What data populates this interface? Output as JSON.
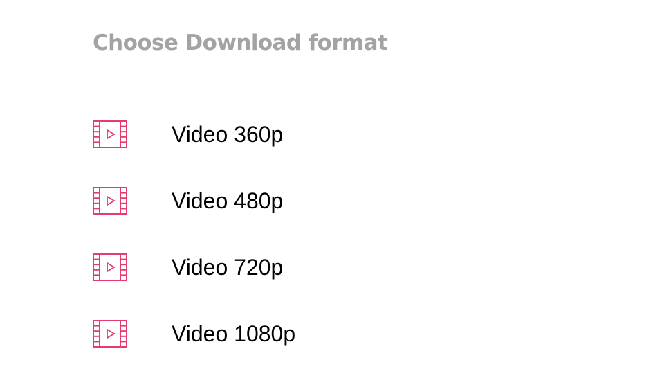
{
  "dialog": {
    "title": "Choose Download format",
    "accent_color": "#e53c6f",
    "title_color": "#a3a3a3",
    "options": [
      {
        "label": "Video 360p",
        "icon": "film-video-icon"
      },
      {
        "label": "Video 480p",
        "icon": "film-video-icon"
      },
      {
        "label": "Video 720p",
        "icon": "film-video-icon"
      },
      {
        "label": "Video 1080p",
        "icon": "film-video-icon"
      }
    ]
  }
}
